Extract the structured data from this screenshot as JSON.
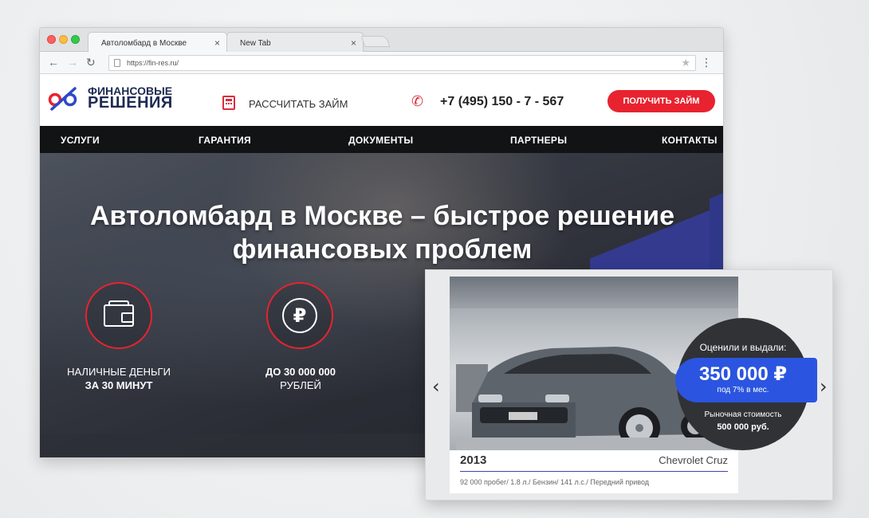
{
  "browser": {
    "tabs": [
      {
        "label": "Автоломбард в Москве",
        "close": "×"
      },
      {
        "label": "New Tab",
        "close": "×"
      }
    ],
    "url": "https://fin-res.ru/",
    "nav_icons": [
      "back-arrow-icon",
      "forward-arrow-icon",
      "reload-icon"
    ],
    "menu_icon": "⋮",
    "star_icon": "★"
  },
  "header": {
    "logo_line1": "ФИНАНСОВЫЕ",
    "logo_line2": "РЕШЕНИЯ",
    "calc_label": "РАССЧИТАТЬ ЗАЙМ",
    "phone": "+7 (495) 150 - 7 - 567",
    "cta": "ПОЛУЧИТЬ ЗАЙМ"
  },
  "nav": [
    "УСЛУГИ",
    "ГАРАНТИЯ",
    "ДОКУМЕНТЫ",
    "ПАРТНЕРЫ",
    "КОНТАКТЫ"
  ],
  "hero": {
    "title_line1": "Автоломбард в Москве – быстрое решение",
    "title_line2": "финансовых проблем",
    "features": [
      {
        "line1": "НАЛИЧНЫЕ ДЕНЬГИ",
        "line2": "ЗА 30 МИНУТ",
        "icon": "wallet-icon"
      },
      {
        "line1": "ДО 30 000 000",
        "line2": "РУБЛЕЙ",
        "icon": "ruble-icon",
        "symbol": "₽"
      }
    ]
  },
  "card": {
    "year": "2013",
    "model": "Chevrolet Cruz",
    "specs": "92 000 пробег/ 1.8 л./ Бензин/ 141 л.с./ Передний привод",
    "prev": "‹",
    "next": "›",
    "badge": {
      "top": "Оценили и выдали:",
      "price": "350 000 ₽",
      "sub": "под 7% в мес.",
      "market_label": "Рыночная стоимость",
      "market_value": "500 000 руб."
    }
  },
  "colors": {
    "accent_red": "#e8232f",
    "brand_blue": "#3c45b7",
    "nav_bg": "#121314"
  }
}
